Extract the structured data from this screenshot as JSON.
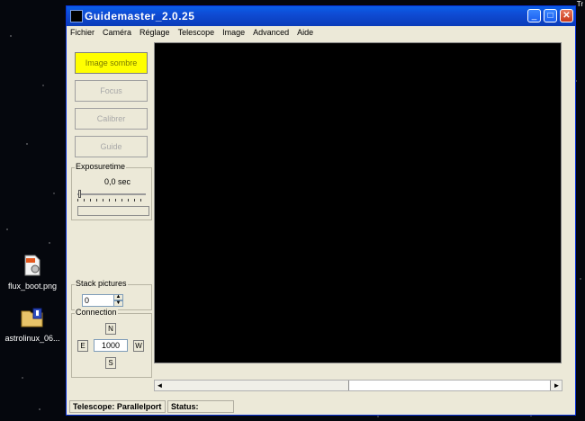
{
  "desktop": {
    "icons": [
      {
        "label": "flux_boot.png",
        "icon": "png-file-icon"
      },
      {
        "label": "astrolinux_06...",
        "icon": "archive-folder-icon"
      }
    ],
    "corner_text": "Tr"
  },
  "window": {
    "title": "Guidemaster_2.0.25",
    "controls": {
      "minimize": "_",
      "maximize": "□",
      "close": "✕"
    }
  },
  "menu": [
    "Fichier",
    "Caméra",
    "Réglage",
    "Telescope",
    "Image",
    "Advanced",
    "Aide"
  ],
  "actions": {
    "dark_image": "Image sombre",
    "focus": "Focus",
    "calibrate": "Calibrer",
    "guide": "Guide"
  },
  "exposure": {
    "title": "Exposuretime",
    "value": "0,0 sec"
  },
  "stack": {
    "title": "Stack pictures",
    "value": "0"
  },
  "connection": {
    "title": "Connection",
    "north": "N",
    "south": "S",
    "east": "E",
    "west": "W",
    "speed": "1000"
  },
  "scroll": {
    "left": "◄",
    "right": "►"
  },
  "status": {
    "telescope": "Telescope: Parallelport",
    "status": "Status:"
  },
  "colors": {
    "active_button": "#ffff00",
    "titlebar": "#0a4fd8",
    "image_bg": "#000000"
  }
}
